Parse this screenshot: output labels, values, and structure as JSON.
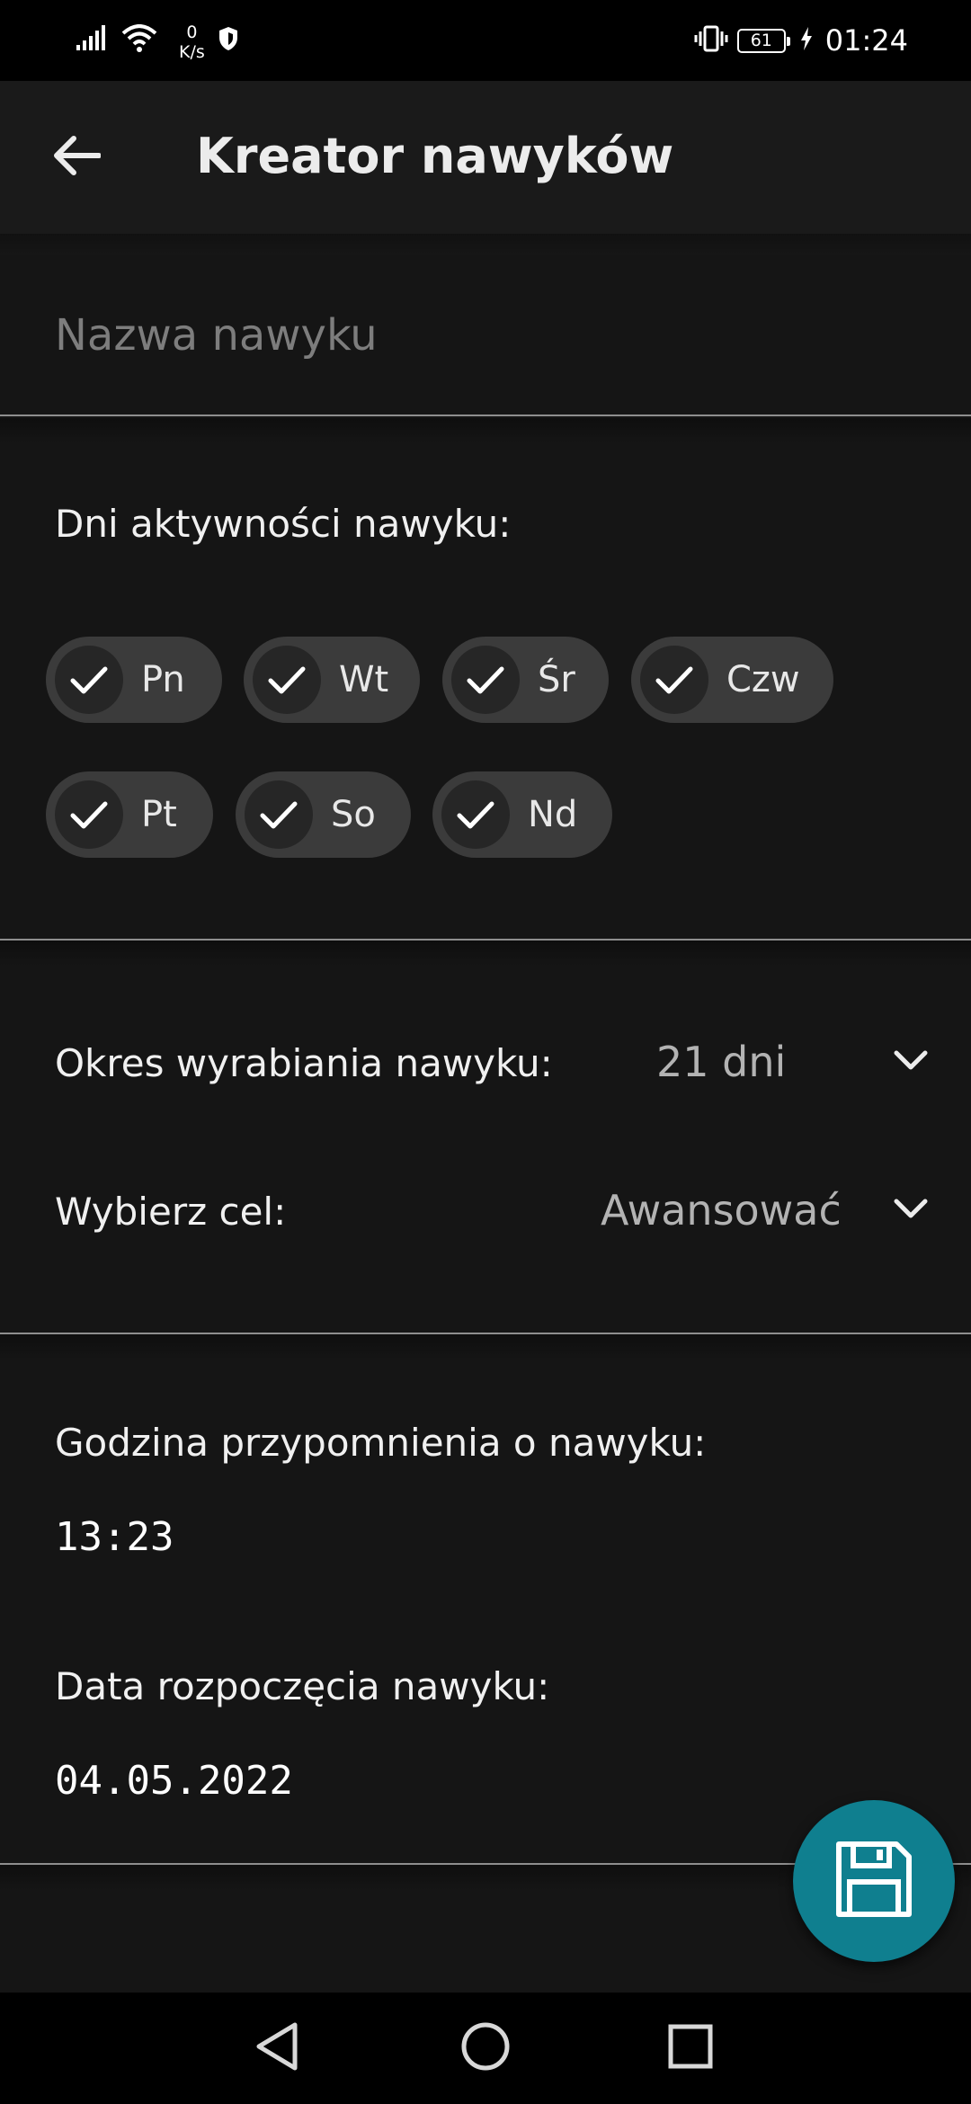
{
  "status_bar": {
    "speed_value": "0",
    "speed_unit": "K/s",
    "battery": "61",
    "time": "01:24",
    "icons": [
      "signal-icon",
      "wifi-icon",
      "shield-icon",
      "vibrate-icon",
      "battery-icon",
      "charging-icon"
    ]
  },
  "app_bar": {
    "title": "Kreator nawyków",
    "back_icon": "arrow-left-icon"
  },
  "form": {
    "name_placeholder": "Nazwa nawyku",
    "name_value": "",
    "days_label": "Dni aktywności nawyku:",
    "days": [
      {
        "label": "Pn",
        "checked": true
      },
      {
        "label": "Wt",
        "checked": true
      },
      {
        "label": "Śr",
        "checked": true
      },
      {
        "label": "Czw",
        "checked": true
      },
      {
        "label": "Pt",
        "checked": true
      },
      {
        "label": "So",
        "checked": true
      },
      {
        "label": "Nd",
        "checked": true
      }
    ],
    "period_label": "Okres wyrabiania nawyku:",
    "period_value": "21 dni",
    "goal_label": "Wybierz cel:",
    "goal_value": "Awansować",
    "reminder_label": "Godzina przypomnienia o nawyku:",
    "reminder_value": "13:23",
    "start_label": "Data rozpoczęcia nawyku:",
    "start_value": "04.05.2022"
  },
  "fab": {
    "icon": "save-icon",
    "color": "#0f7f8f"
  },
  "nav_bar": {
    "icons": [
      "back-triangle-icon",
      "home-circle-icon",
      "recents-square-icon"
    ]
  }
}
